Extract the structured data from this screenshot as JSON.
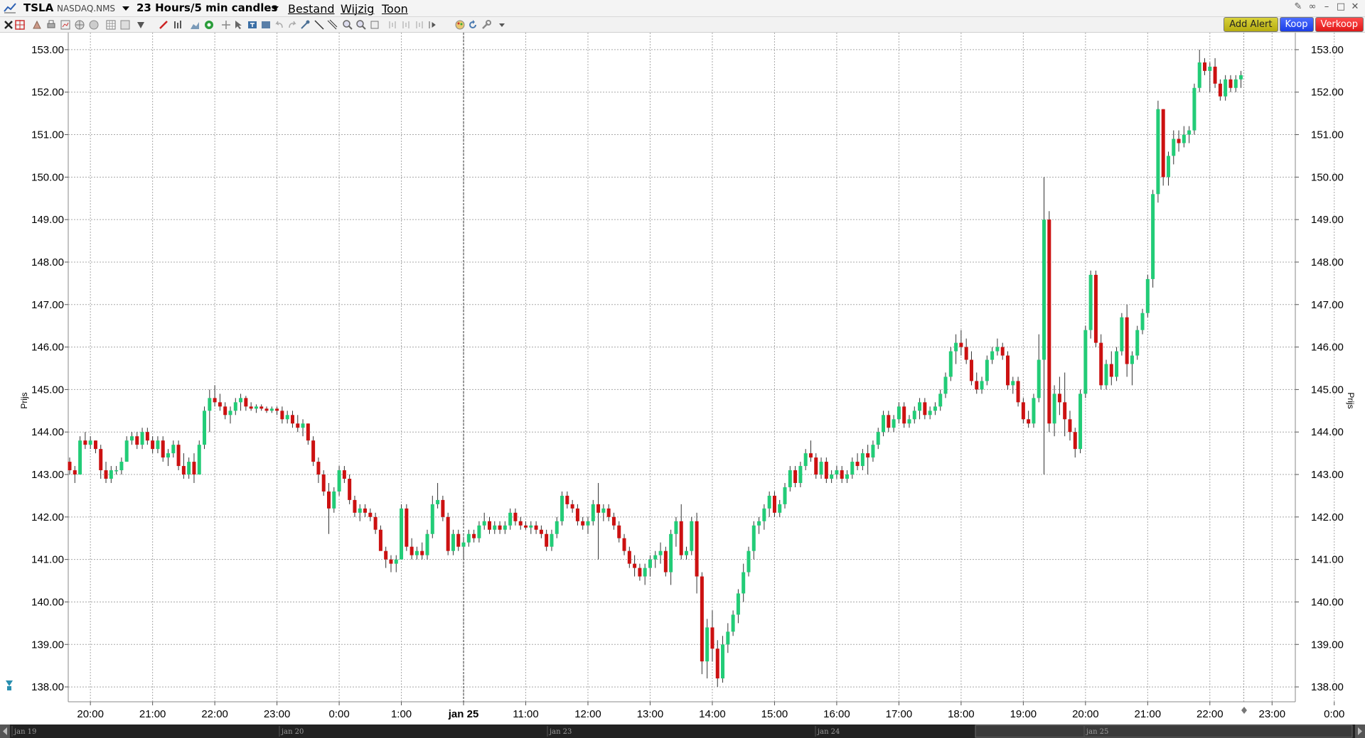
{
  "window": {
    "symbol": "TSLA",
    "exchange": "NASDAQ.NMS",
    "interval": "23 Hours/5 min candles",
    "menus": [
      "Bestand",
      "Wijzig",
      "Toon"
    ]
  },
  "actions": {
    "add_alert": "Add Alert",
    "buy": "Koop",
    "sell": "Verkoop"
  },
  "colors": {
    "up": "#22cc77",
    "down": "#cc1111",
    "grid": "#a8a8a8",
    "session_line": "#333333"
  },
  "toolbar_icons": [
    "close-icon",
    "crosshair-icon",
    "hand-icon",
    "print-icon",
    "chart-icon",
    "globe-icon",
    "refresh-icon",
    "grid-icon",
    "square-icon",
    "triangle-icon",
    "pencil-icon",
    "bars-icon",
    "area-icon",
    "circle-icon",
    "plus-icon",
    "pointer-icon",
    "text-icon",
    "undo-icon",
    "redo-icon",
    "zoom-in-icon",
    "zoom-out-icon",
    "settings-icon",
    "dropdown-icon"
  ],
  "chart_data": {
    "type": "candlestick",
    "ylabel": "Prijs",
    "ylim": [
      137.65,
      153.4
    ],
    "yticks": [
      "153.00",
      "152.00",
      "151.00",
      "150.00",
      "149.00",
      "148.00",
      "147.00",
      "146.00",
      "145.00",
      "144.00",
      "143.00",
      "142.00",
      "141.00",
      "140.00",
      "139.00",
      "138.00"
    ],
    "ytick_values": [
      153,
      152,
      151,
      150,
      149,
      148,
      147,
      146,
      145,
      144,
      143,
      142,
      141,
      140,
      139,
      138
    ],
    "xticks": [
      "20:00",
      "21:00",
      "22:00",
      "23:00",
      "0:00",
      "1:00",
      "jan 25",
      "11:00",
      "12:00",
      "13:00",
      "14:00",
      "15:00",
      "16:00",
      "17:00",
      "18:00",
      "19:00",
      "20:00",
      "21:00",
      "22:00",
      "23:00",
      "0:00",
      "1:00"
    ],
    "xtick_bold": "jan 25",
    "session_break": "jan 25",
    "legend": "none",
    "grid": true,
    "navigator_labels": [
      "jan 19",
      "jan 20",
      "jan 23",
      "jan 24",
      "jan 25"
    ],
    "candles": [
      [
        143.3,
        143.4,
        143.0,
        143.1
      ],
      [
        143.1,
        143.2,
        142.8,
        143.0
      ],
      [
        143.0,
        143.9,
        143.0,
        143.8
      ],
      [
        143.8,
        144.0,
        143.6,
        143.7
      ],
      [
        143.7,
        143.9,
        143.6,
        143.8
      ],
      [
        143.8,
        143.8,
        143.5,
        143.6
      ],
      [
        143.6,
        143.7,
        142.9,
        143.1
      ],
      [
        143.1,
        143.3,
        142.8,
        142.9
      ],
      [
        142.9,
        143.2,
        142.8,
        143.1
      ],
      [
        143.1,
        143.2,
        143.0,
        143.1
      ],
      [
        143.1,
        143.4,
        143.0,
        143.3
      ],
      [
        143.3,
        143.9,
        143.3,
        143.8
      ],
      [
        143.8,
        144.0,
        143.7,
        143.9
      ],
      [
        143.9,
        144.0,
        143.6,
        143.7
      ],
      [
        143.7,
        144.1,
        143.6,
        144.0
      ],
      [
        144.0,
        144.1,
        143.7,
        143.8
      ],
      [
        143.8,
        143.9,
        143.5,
        143.6
      ],
      [
        143.6,
        143.9,
        143.5,
        143.8
      ],
      [
        143.8,
        143.9,
        143.3,
        143.4
      ],
      [
        143.4,
        143.6,
        143.2,
        143.5
      ],
      [
        143.5,
        143.8,
        143.4,
        143.7
      ],
      [
        143.7,
        143.8,
        143.1,
        143.2
      ],
      [
        143.2,
        143.5,
        142.9,
        143.0
      ],
      [
        143.0,
        143.4,
        142.9,
        143.3
      ],
      [
        143.3,
        143.5,
        142.8,
        143.0
      ],
      [
        143.0,
        143.8,
        143.0,
        143.7
      ],
      [
        143.7,
        144.6,
        143.6,
        144.5
      ],
      [
        144.5,
        145.0,
        144.0,
        144.8
      ],
      [
        144.8,
        145.1,
        144.6,
        144.7
      ],
      [
        144.7,
        144.9,
        144.5,
        144.6
      ],
      [
        144.6,
        144.7,
        144.3,
        144.4
      ],
      [
        144.4,
        144.6,
        144.2,
        144.5
      ],
      [
        144.5,
        144.8,
        144.4,
        144.7
      ],
      [
        144.7,
        144.9,
        144.5,
        144.8
      ],
      [
        144.8,
        144.85,
        144.5,
        144.6
      ],
      [
        144.6,
        144.7,
        144.5,
        144.55
      ],
      [
        144.55,
        144.65,
        144.45,
        144.6
      ],
      [
        144.6,
        144.65,
        144.5,
        144.55
      ],
      [
        144.55,
        144.6,
        144.45,
        144.5
      ],
      [
        144.5,
        144.6,
        144.45,
        144.55
      ],
      [
        144.55,
        144.6,
        144.4,
        144.5
      ],
      [
        144.5,
        144.6,
        144.2,
        144.3
      ],
      [
        144.3,
        144.5,
        144.2,
        144.4
      ],
      [
        144.4,
        144.5,
        144.1,
        144.2
      ],
      [
        144.2,
        144.4,
        144.0,
        144.1
      ],
      [
        144.1,
        144.3,
        143.9,
        144.2
      ],
      [
        144.2,
        144.2,
        143.7,
        143.8
      ],
      [
        143.8,
        143.9,
        143.2,
        143.3
      ],
      [
        143.3,
        143.4,
        142.8,
        143.0
      ],
      [
        143.0,
        143.1,
        142.5,
        142.6
      ],
      [
        142.6,
        142.8,
        141.6,
        142.2
      ],
      [
        142.2,
        142.7,
        142.1,
        142.6
      ],
      [
        142.6,
        143.2,
        142.5,
        143.1
      ],
      [
        143.1,
        143.2,
        142.8,
        142.9
      ],
      [
        142.9,
        143.0,
        142.3,
        142.4
      ],
      [
        142.4,
        142.5,
        142.0,
        142.1
      ],
      [
        142.1,
        142.3,
        141.9,
        142.2
      ],
      [
        142.2,
        142.3,
        142.0,
        142.1
      ],
      [
        142.1,
        142.2,
        141.9,
        142.0
      ],
      [
        142.0,
        142.1,
        141.6,
        141.7
      ],
      [
        141.7,
        141.8,
        141.3,
        141.2
      ],
      [
        141.2,
        141.3,
        140.8,
        141.0
      ],
      [
        141.0,
        141.1,
        140.7,
        140.9
      ],
      [
        140.9,
        141.1,
        140.7,
        141.0
      ],
      [
        141.0,
        142.3,
        141.0,
        142.2
      ],
      [
        142.2,
        142.3,
        141.2,
        141.3
      ],
      [
        141.3,
        141.5,
        141.0,
        141.1
      ],
      [
        141.1,
        141.3,
        141.0,
        141.2
      ],
      [
        141.2,
        141.4,
        141.0,
        141.1
      ],
      [
        141.1,
        141.7,
        141.0,
        141.6
      ],
      [
        141.6,
        142.5,
        141.5,
        142.3
      ],
      [
        142.3,
        142.8,
        142.2,
        142.4
      ],
      [
        142.4,
        142.5,
        141.9,
        142.0
      ],
      [
        142.0,
        142.1,
        141.1,
        141.2
      ],
      [
        141.2,
        141.7,
        141.1,
        141.6
      ],
      [
        141.6,
        141.7,
        141.2,
        141.3
      ],
      [
        141.3,
        141.5,
        141.0,
        141.4
      ],
      [
        141.4,
        141.7,
        141.3,
        141.6
      ],
      [
        141.6,
        141.7,
        141.4,
        141.5
      ],
      [
        141.5,
        141.9,
        141.4,
        141.8
      ],
      [
        141.8,
        142.1,
        141.7,
        141.9
      ],
      [
        141.9,
        142.0,
        141.6,
        141.7
      ],
      [
        141.7,
        141.9,
        141.6,
        141.8
      ],
      [
        141.8,
        141.9,
        141.6,
        141.7
      ],
      [
        141.7,
        141.9,
        141.6,
        141.8
      ],
      [
        141.8,
        142.2,
        141.7,
        142.1
      ],
      [
        142.1,
        142.2,
        141.8,
        141.9
      ],
      [
        141.9,
        142.0,
        141.7,
        141.8
      ],
      [
        141.8,
        141.9,
        141.7,
        141.75
      ],
      [
        141.75,
        141.9,
        141.6,
        141.8
      ],
      [
        141.8,
        141.9,
        141.6,
        141.7
      ],
      [
        141.7,
        141.8,
        141.5,
        141.6
      ],
      [
        141.6,
        141.7,
        141.2,
        141.3
      ],
      [
        141.3,
        141.7,
        141.2,
        141.6
      ],
      [
        141.6,
        142.0,
        141.5,
        141.9
      ],
      [
        141.9,
        142.6,
        141.8,
        142.5
      ],
      [
        142.5,
        142.6,
        142.2,
        142.3
      ],
      [
        142.3,
        142.4,
        142.1,
        142.2
      ],
      [
        142.2,
        142.3,
        141.8,
        141.9
      ],
      [
        141.9,
        142.0,
        141.7,
        141.8
      ],
      [
        141.8,
        142.0,
        141.6,
        141.9
      ],
      [
        141.9,
        142.4,
        141.8,
        142.3
      ],
      [
        142.3,
        142.8,
        141.0,
        142.1
      ],
      [
        142.1,
        142.3,
        141.9,
        142.2
      ],
      [
        142.2,
        142.3,
        141.9,
        142.0
      ],
      [
        142.0,
        142.1,
        141.7,
        141.8
      ],
      [
        141.8,
        141.9,
        141.4,
        141.5
      ],
      [
        141.5,
        141.6,
        141.1,
        141.2
      ],
      [
        141.2,
        141.3,
        140.8,
        140.9
      ],
      [
        140.9,
        141.1,
        140.6,
        140.8
      ],
      [
        140.8,
        140.9,
        140.5,
        140.6
      ],
      [
        140.6,
        140.9,
        140.4,
        140.8
      ],
      [
        140.8,
        141.1,
        140.6,
        141.0
      ],
      [
        141.0,
        141.2,
        140.8,
        141.1
      ],
      [
        141.1,
        141.4,
        140.9,
        141.2
      ],
      [
        141.2,
        141.3,
        140.6,
        140.7
      ],
      [
        140.7,
        141.7,
        140.4,
        141.6
      ],
      [
        141.6,
        142.0,
        141.3,
        141.9
      ],
      [
        141.9,
        142.3,
        141.0,
        141.1
      ],
      [
        141.1,
        141.3,
        141.0,
        141.2
      ],
      [
        141.2,
        142.0,
        141.1,
        141.9
      ],
      [
        141.9,
        142.1,
        140.2,
        140.6
      ],
      [
        140.6,
        140.7,
        138.3,
        138.6
      ],
      [
        138.6,
        139.6,
        138.2,
        139.4
      ],
      [
        139.4,
        139.8,
        138.6,
        138.9
      ],
      [
        138.9,
        139.1,
        138.0,
        138.2
      ],
      [
        138.2,
        139.2,
        138.1,
        139.0
      ],
      [
        139.0,
        139.5,
        138.8,
        139.3
      ],
      [
        139.3,
        139.8,
        139.2,
        139.7
      ],
      [
        139.7,
        140.3,
        139.5,
        140.2
      ],
      [
        140.2,
        140.9,
        140.0,
        140.7
      ],
      [
        140.7,
        141.3,
        140.6,
        141.2
      ],
      [
        141.2,
        141.9,
        141.0,
        141.8
      ],
      [
        141.8,
        142.0,
        141.6,
        141.9
      ],
      [
        141.9,
        142.3,
        141.7,
        142.2
      ],
      [
        142.2,
        142.6,
        142.0,
        142.5
      ],
      [
        142.5,
        142.6,
        142.0,
        142.1
      ],
      [
        142.1,
        142.4,
        142.0,
        142.3
      ],
      [
        142.3,
        142.8,
        142.2,
        142.7
      ],
      [
        142.7,
        143.2,
        142.6,
        143.1
      ],
      [
        143.1,
        143.2,
        142.7,
        142.8
      ],
      [
        142.8,
        143.3,
        142.7,
        143.2
      ],
      [
        143.2,
        143.6,
        143.1,
        143.5
      ],
      [
        143.5,
        143.8,
        143.3,
        143.4
      ],
      [
        143.4,
        143.5,
        142.9,
        143.0
      ],
      [
        143.0,
        143.4,
        142.9,
        143.3
      ],
      [
        143.3,
        143.4,
        142.8,
        142.9
      ],
      [
        142.9,
        143.1,
        142.8,
        143.0
      ],
      [
        143.0,
        143.2,
        142.9,
        143.1
      ],
      [
        143.1,
        143.2,
        142.8,
        142.9
      ],
      [
        142.9,
        143.1,
        142.8,
        143.0
      ],
      [
        143.0,
        143.4,
        142.9,
        143.3
      ],
      [
        143.3,
        143.5,
        143.1,
        143.2
      ],
      [
        143.2,
        143.6,
        143.1,
        143.5
      ],
      [
        143.5,
        143.7,
        143.0,
        143.4
      ],
      [
        143.4,
        143.8,
        143.3,
        143.7
      ],
      [
        143.7,
        144.1,
        143.6,
        144.0
      ],
      [
        144.0,
        144.5,
        143.9,
        144.4
      ],
      [
        144.4,
        144.5,
        144.0,
        144.1
      ],
      [
        144.1,
        144.4,
        144.0,
        144.3
      ],
      [
        144.3,
        144.7,
        144.2,
        144.6
      ],
      [
        144.6,
        144.7,
        144.1,
        144.2
      ],
      [
        144.2,
        144.4,
        144.1,
        144.3
      ],
      [
        144.3,
        144.6,
        144.2,
        144.5
      ],
      [
        144.5,
        144.8,
        144.3,
        144.7
      ],
      [
        144.7,
        144.8,
        144.3,
        144.4
      ],
      [
        144.4,
        144.6,
        144.3,
        144.5
      ],
      [
        144.5,
        144.7,
        144.4,
        144.6
      ],
      [
        144.6,
        145.0,
        144.5,
        144.9
      ],
      [
        144.9,
        145.4,
        144.8,
        145.3
      ],
      [
        145.3,
        146.0,
        145.2,
        145.9
      ],
      [
        145.9,
        146.3,
        145.6,
        146.1
      ],
      [
        146.1,
        146.4,
        145.8,
        146.0
      ],
      [
        146.0,
        146.2,
        145.6,
        145.7
      ],
      [
        145.7,
        145.9,
        145.1,
        145.2
      ],
      [
        145.2,
        145.4,
        144.9,
        145.0
      ],
      [
        145.0,
        145.3,
        144.9,
        145.2
      ],
      [
        145.2,
        145.8,
        145.1,
        145.7
      ],
      [
        145.7,
        146.0,
        145.6,
        145.9
      ],
      [
        145.9,
        146.2,
        145.8,
        146.0
      ],
      [
        146.0,
        146.1,
        145.7,
        145.8
      ],
      [
        145.8,
        145.9,
        145.0,
        145.1
      ],
      [
        145.1,
        145.3,
        144.9,
        145.2
      ],
      [
        145.2,
        145.3,
        144.6,
        144.7
      ],
      [
        144.7,
        144.8,
        144.2,
        144.3
      ],
      [
        144.3,
        144.5,
        144.1,
        144.2
      ],
      [
        144.2,
        144.9,
        144.1,
        144.8
      ],
      [
        144.8,
        146.3,
        144.7,
        145.7
      ],
      [
        145.7,
        150.0,
        143.0,
        149.0
      ],
      [
        149.0,
        149.2,
        144.0,
        144.2
      ],
      [
        144.2,
        145.1,
        143.9,
        144.9
      ],
      [
        144.9,
        145.3,
        144.4,
        144.7
      ],
      [
        144.7,
        145.4,
        143.9,
        144.3
      ],
      [
        144.3,
        144.5,
        143.8,
        144.0
      ],
      [
        144.0,
        144.1,
        143.4,
        143.6
      ],
      [
        143.6,
        145.0,
        143.5,
        144.9
      ],
      [
        144.9,
        146.5,
        144.8,
        146.4
      ],
      [
        146.4,
        147.8,
        146.2,
        147.7
      ],
      [
        147.7,
        147.8,
        146.0,
        146.1
      ],
      [
        146.1,
        146.3,
        145.0,
        145.1
      ],
      [
        145.1,
        145.7,
        145.0,
        145.6
      ],
      [
        145.6,
        145.9,
        145.1,
        145.3
      ],
      [
        145.3,
        146.0,
        145.2,
        145.9
      ],
      [
        145.9,
        146.8,
        145.8,
        146.7
      ],
      [
        146.7,
        147.0,
        145.3,
        145.6
      ],
      [
        145.6,
        145.9,
        145.1,
        145.8
      ],
      [
        145.8,
        146.5,
        145.7,
        146.4
      ],
      [
        146.4,
        146.9,
        146.3,
        146.8
      ],
      [
        146.8,
        147.7,
        146.7,
        147.6
      ],
      [
        147.6,
        149.7,
        147.4,
        149.6
      ],
      [
        149.6,
        151.8,
        149.4,
        151.6
      ],
      [
        151.6,
        151.6,
        149.8,
        150.0
      ],
      [
        150.0,
        150.6,
        149.8,
        150.5
      ],
      [
        150.5,
        151.1,
        150.3,
        150.9
      ],
      [
        150.9,
        151.1,
        150.6,
        150.8
      ],
      [
        150.8,
        151.2,
        150.7,
        151.0
      ],
      [
        151.0,
        151.2,
        150.8,
        151.1
      ],
      [
        151.1,
        152.2,
        151.0,
        152.1
      ],
      [
        152.1,
        153.0,
        152.0,
        152.7
      ],
      [
        152.7,
        152.8,
        152.4,
        152.5
      ],
      [
        152.5,
        152.7,
        152.0,
        152.6
      ],
      [
        152.6,
        152.8,
        152.1,
        152.2
      ],
      [
        152.2,
        152.3,
        151.8,
        151.9
      ],
      [
        151.9,
        152.4,
        151.8,
        152.3
      ],
      [
        152.3,
        152.4,
        152.0,
        152.1
      ],
      [
        152.1,
        152.4,
        152.0,
        152.3
      ],
      [
        152.3,
        152.5,
        152.1,
        152.4
      ]
    ]
  }
}
